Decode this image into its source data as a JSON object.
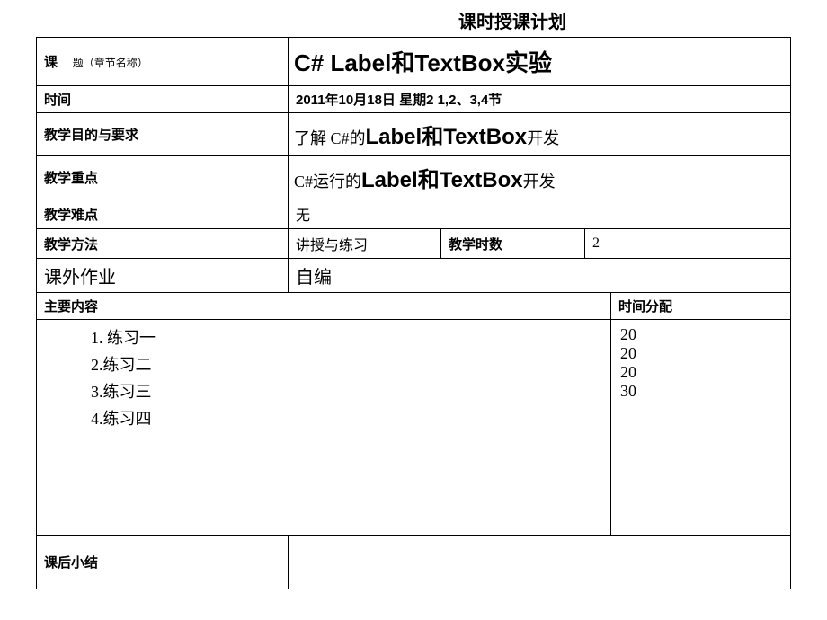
{
  "title": "课时授课计划",
  "rows": {
    "topic": {
      "label_main": "课",
      "label_sub": "题（章节名称）",
      "value": "C# Label和TextBox实验"
    },
    "time": {
      "label": "时间",
      "value": "2011年10月18日 星期2  1,2、3,4节"
    },
    "goal": {
      "label": "教学目的与要求",
      "prefix": "了解 C#的",
      "big": "Label和TextBox",
      "suffix": "开发"
    },
    "focus": {
      "label": "教学重点",
      "prefix": "C#运行的",
      "big": "Label和TextBox",
      "suffix": "开发"
    },
    "difficulty": {
      "label": "教学难点",
      "value": "无"
    },
    "method": {
      "label": "教学方法",
      "value": "讲授与练习",
      "hours_label": "教学时数",
      "hours_value": "2"
    },
    "homework": {
      "label": "课外作业",
      "value": "自编"
    },
    "content": {
      "label": "主要内容",
      "time_label": "时间分配",
      "items": [
        {
          "num": "1.",
          "text": "练习一",
          "time": "20"
        },
        {
          "num": "2.",
          "text": "练习二",
          "time": "20"
        },
        {
          "num": "3.",
          "text": "练习三",
          "time": "20"
        },
        {
          "num": "4.",
          "text": "练习四",
          "time": "30"
        }
      ]
    },
    "summary": {
      "label": "课后小结"
    }
  }
}
